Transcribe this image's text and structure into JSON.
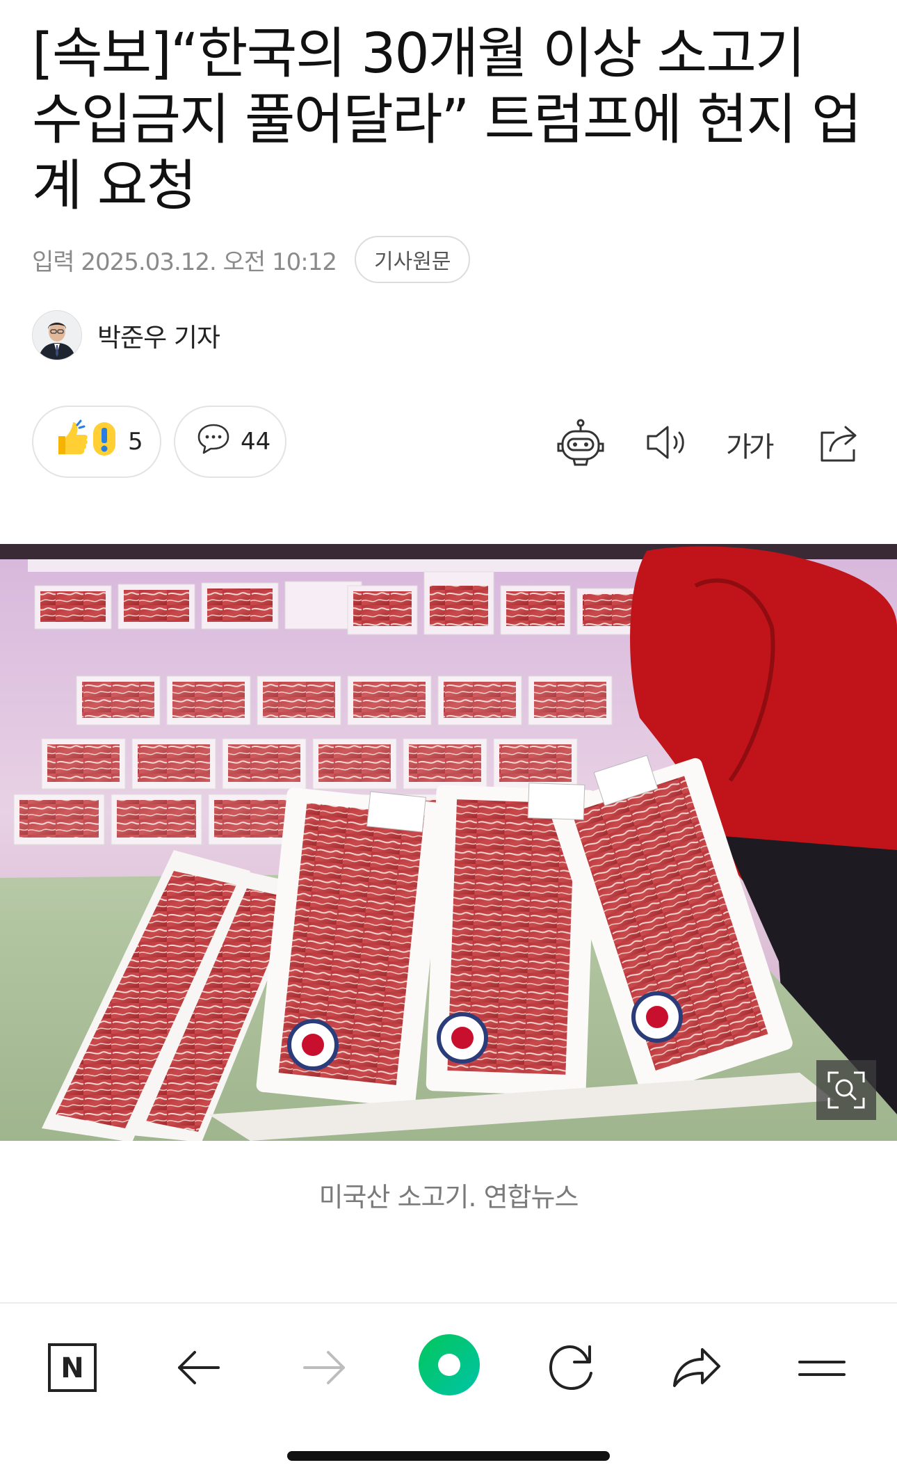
{
  "article": {
    "headline": "[속보]“한국의 30개월 이상 소고기 수입금지 풀어달라” 트럼프에 현지 업계 요청",
    "date": "입력 2025.03.12. 오전 10:12",
    "original_button": "기사원문",
    "reporter": "박준우 기자"
  },
  "reactions": {
    "reaction_count": "5",
    "comment_count": "44"
  },
  "tools": {
    "icons": [
      "robot-summary-icon",
      "speaker-icon",
      "font-size-icon",
      "share-icon"
    ],
    "font_size_label": "가가"
  },
  "photo": {
    "caption": "미국산 소고기. 연합뉴스",
    "zoom_icon": "zoom-icon"
  },
  "toolbar": {
    "icons": [
      "naver-n-icon",
      "back-arrow-icon",
      "forward-arrow-icon",
      "green-dot-icon",
      "refresh-icon",
      "share-arrow-icon",
      "menu-icon"
    ],
    "naver_label": "N",
    "accent_color": "#03c75a"
  }
}
